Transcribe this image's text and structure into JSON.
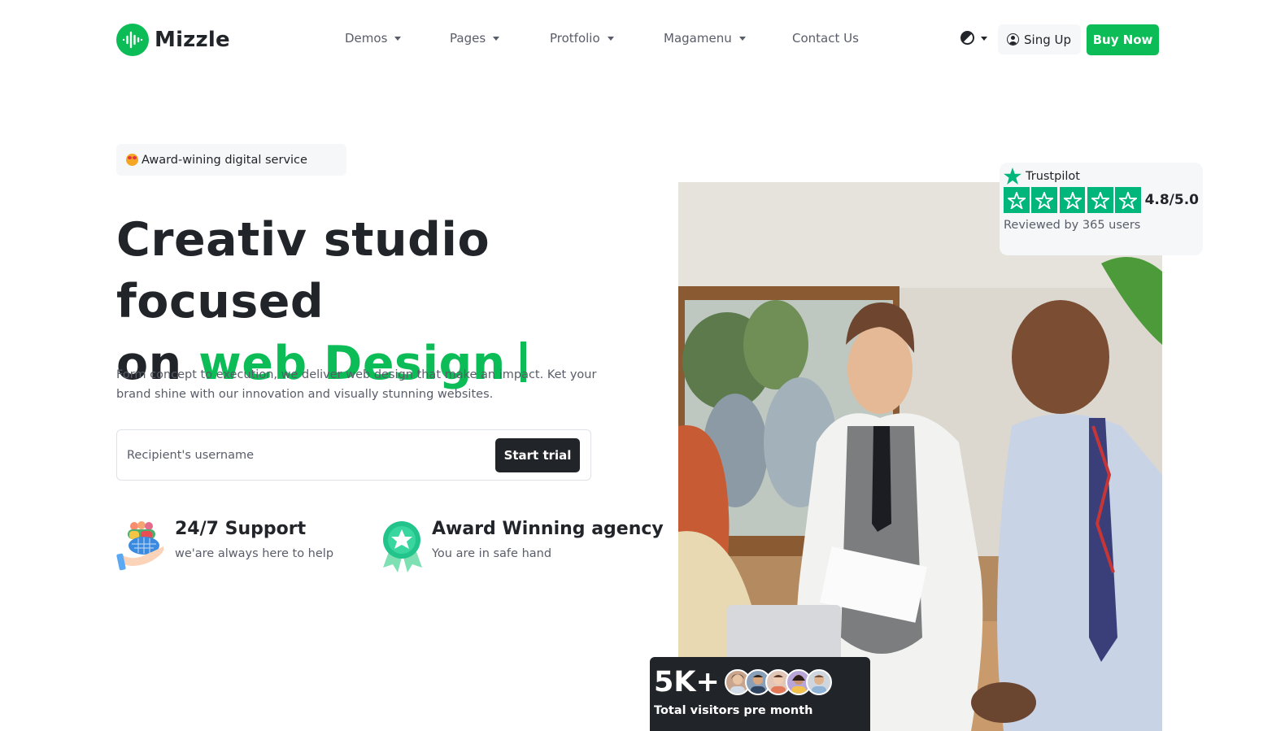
{
  "brand": {
    "name": "Mizzle",
    "accent": "#0cbc56",
    "dark": "#212529"
  },
  "nav": {
    "items": [
      {
        "label": "Demos",
        "dropdown": true
      },
      {
        "label": "Pages",
        "dropdown": true
      },
      {
        "label": "Protfolio",
        "dropdown": true
      },
      {
        "label": "Magamenu",
        "dropdown": true
      },
      {
        "label": "Contact Us",
        "dropdown": false
      }
    ],
    "theme_icon": "half-circle-contrast-icon",
    "signup_label": "Sing Up",
    "buy_label": "Buy Now"
  },
  "hero": {
    "badge": "Award-wining digital service",
    "title_line1": "Creativ studio focused",
    "title_line2_prefix": "on ",
    "title_line2_accent": "web Design",
    "description": "Form concept to execution, we deliver web design that make an impact. Ket your brand shine with our innovation and visually stunning websites.",
    "input_placeholder": "Recipient's username",
    "cta_label": "Start trial"
  },
  "features": [
    {
      "title": "24/7 Support",
      "subtitle": "we'are always here to help",
      "icon": "support-hand-icon"
    },
    {
      "title": "Award Winning agency",
      "subtitle": "You are in safe hand",
      "icon": "award-badge-icon"
    }
  ],
  "trustpilot": {
    "brand": "Trustpilot",
    "stars": 5,
    "rating": "4.8/5.0",
    "reviewed": "Reviewed by 365 users",
    "star_color": "#00b67a"
  },
  "visitors": {
    "count": "5K+",
    "label": "Total visitors pre month",
    "avatar_count": 5
  }
}
